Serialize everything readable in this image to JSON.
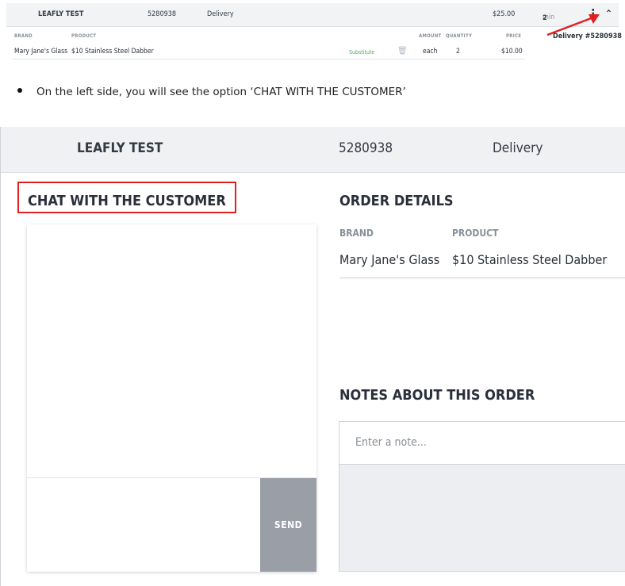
{
  "mini": {
    "customer_name": "LEAFLY TEST",
    "order_id": "5280938",
    "order_type": "Delivery",
    "total": "$25.00",
    "time_value": "2",
    "time_unit": "min",
    "more_icon": "vertical-dots-icon",
    "collapse_icon": "chevron-up-icon",
    "columns": {
      "brand": "BRAND",
      "product": "PRODUCT",
      "amount": "AMOUNT",
      "quantity": "QUANTITY",
      "price": "PRICE"
    },
    "item": {
      "brand": "Mary Jane's Glass",
      "product": "$10 Stainless Steel Dabber",
      "substitute": "Substitute",
      "amount": "each",
      "quantity": "2",
      "price": "$10.00"
    },
    "delivery_label": "Delivery #5280938",
    "arrow_color": "#e02020"
  },
  "instruction": "On the left side, you will see the option ‘CHAT WITH THE CUSTOMER’",
  "order": {
    "customer_name": "LEAFLY TEST",
    "order_id": "5280938",
    "order_type": "Delivery",
    "chat_title": "CHAT WITH THE CUSTOMER",
    "send_label": "SEND",
    "order_details_title": "ORDER DETAILS",
    "columns": {
      "brand": "BRAND",
      "product": "PRODUCT"
    },
    "item": {
      "brand": "Mary Jane's Glass",
      "product": "$10 Stainless Steel Dabber"
    },
    "notes_title": "NOTES ABOUT THIS ORDER",
    "note_placeholder": "Enter a note...",
    "highlight_color": "#e02020"
  }
}
